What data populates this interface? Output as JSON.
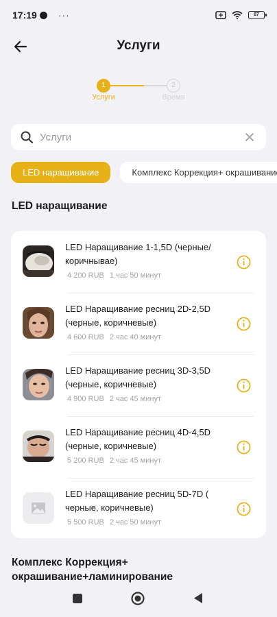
{
  "status_bar": {
    "time": "17:19",
    "dots": "···",
    "battery": "87"
  },
  "header": {
    "title": "Услуги"
  },
  "stepper": {
    "steps": [
      {
        "number": "1",
        "label": "Услуги",
        "active": true
      },
      {
        "number": "2",
        "label": "Время",
        "active": false
      }
    ],
    "progress": 0.6
  },
  "search": {
    "placeholder": "Услуги",
    "value": ""
  },
  "chips": [
    {
      "label": "LED наращивание",
      "active": true
    },
    {
      "label": "Комплекс Коррекция+ окрашивание+ламинирование",
      "active": false
    }
  ],
  "sections": [
    {
      "title": "LED наращивание",
      "services": [
        {
          "name": "LED Наращивание 1-1,5D (черные/ коричнывае)",
          "price": "4 200 RUB",
          "duration": "1 час 50 минут",
          "thumb": "photo-lashes-icon"
        },
        {
          "name": "LED Наращивание ресниц 2D-2,5D (черные, коричневые)",
          "price": "4 600 RUB",
          "duration": "2 час 40 минут",
          "thumb": "photo-face-icon"
        },
        {
          "name": "LED Наращивание ресниц 3D-3,5D (черные, коричневые)",
          "price": "4 900 RUB",
          "duration": "2 час 45 минут",
          "thumb": "photo-face-icon"
        },
        {
          "name": "LED Наращивание ресниц 4D-4,5D (черные, коричневые)",
          "price": "5 200 RUB",
          "duration": "2 час 45 минут",
          "thumb": "photo-face-icon"
        },
        {
          "name": "LED Наращивание ресниц 5D-7D ( черные, коричневые)",
          "price": "5 500 RUB",
          "duration": "2 час 50 минут",
          "thumb": "image-placeholder-icon"
        }
      ]
    },
    {
      "title": "Комплекс Коррекция+ окрашивание+ламинирование",
      "services": []
    }
  ],
  "colors": {
    "accent": "#e8b117",
    "background": "#f2f2f6",
    "card": "#ffffff"
  }
}
